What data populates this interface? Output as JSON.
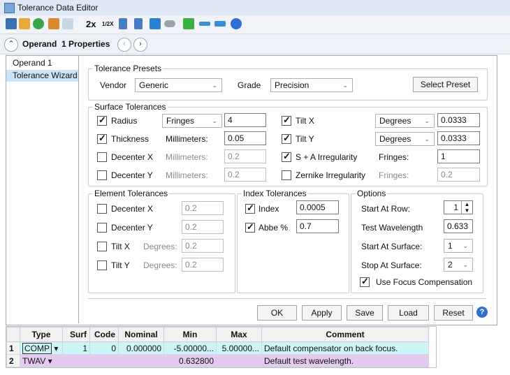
{
  "window": {
    "title": "Tolerance Data Editor"
  },
  "toolbar": {
    "icons": [
      "save-icon",
      "load-icon",
      "check-icon",
      "wizard-icon",
      "convert-icon",
      "double-icon",
      "half-icon",
      "sort-num-icon",
      "sort-alpha-icon",
      "undo-icon",
      "toggle-icon",
      "insert-row-icon",
      "dots-icon",
      "arrow-icon",
      "help-icon"
    ],
    "double_label": "2x",
    "half_label": "1/2X"
  },
  "operand_bar": {
    "label": "Operand  1 Properties"
  },
  "nav": {
    "items": [
      "Operand 1",
      "Tolerance Wizard"
    ],
    "selected": "Tolerance Wizard"
  },
  "presets": {
    "title": "Tolerance Presets",
    "vendor_label": "Vendor",
    "vendor_value": "Generic",
    "grade_label": "Grade",
    "grade_value": "Precision",
    "select_button": "Select Preset"
  },
  "surface": {
    "title": "Surface Tolerances",
    "radius": {
      "label": "Radius",
      "checked": true,
      "unit": "Fringes",
      "value": "4"
    },
    "thickness": {
      "label": "Thickness",
      "checked": true,
      "unit": "Millimeters:",
      "value": "0.05"
    },
    "decenter_x": {
      "label": "Decenter X",
      "checked": false,
      "unit": "Millimeters:",
      "value": "0.2"
    },
    "decenter_y": {
      "label": "Decenter Y",
      "checked": false,
      "unit": "Millimeters:",
      "value": "0.2"
    },
    "tilt_x": {
      "label": "Tilt X",
      "checked": true,
      "unit": "Degrees",
      "value": "0.0333"
    },
    "tilt_y": {
      "label": "Tilt Y",
      "checked": true,
      "unit": "Degrees",
      "value": "0.0333"
    },
    "sa_irreg": {
      "label": "S + A Irregularity",
      "checked": true,
      "unit": "Fringes:",
      "value": "1"
    },
    "zernike": {
      "label": "Zernike Irregularity",
      "checked": false,
      "unit": "Fringes:",
      "value": "0.2"
    }
  },
  "element": {
    "title": "Element Tolerances",
    "decenter_x": {
      "label": "Decenter X",
      "value": "0.2"
    },
    "decenter_y": {
      "label": "Decenter Y",
      "value": "0.2"
    },
    "tilt_x": {
      "label": "Tilt X",
      "unit": "Degrees:",
      "value": "0.2"
    },
    "tilt_y": {
      "label": "Tilt Y",
      "unit": "Degrees:",
      "value": "0.2"
    }
  },
  "index": {
    "title": "Index Tolerances",
    "index": {
      "label": "Index",
      "checked": true,
      "value": "0.0005"
    },
    "abbe": {
      "label": "Abbe %",
      "checked": true,
      "value": "0.7"
    }
  },
  "options": {
    "title": "Options",
    "start_row_label": "Start At Row:",
    "start_row_value": "1",
    "wavelength_label": "Test Wavelength",
    "wavelength_value": "0.633",
    "start_surface_label": "Start At Surface:",
    "start_surface_value": "1",
    "stop_surface_label": "Stop At Surface:",
    "stop_surface_value": "2",
    "focus_comp_label": "Use Focus Compensation",
    "focus_comp_checked": true
  },
  "buttons": {
    "ok": "OK",
    "apply": "Apply",
    "save": "Save",
    "load": "Load",
    "reset": "Reset"
  },
  "grid": {
    "headers": [
      "",
      "Type",
      "Surf",
      "Code",
      "Nominal",
      "Min",
      "Max",
      "Comment"
    ],
    "rows": [
      {
        "num": "1",
        "type": "COMP",
        "surf": "1",
        "code": "0",
        "nominal": "0.000000",
        "min": "-5.00000...",
        "max": "5.00000...",
        "comment": "Default compensator on back focus."
      },
      {
        "num": "2",
        "type": "TWAV",
        "surf": "",
        "code": "",
        "nominal": "",
        "min": "0.632800",
        "max": "",
        "comment": "Default test wavelength."
      }
    ]
  },
  "colors": {
    "row1": "#cdf5f7",
    "row2": "#e4c9f0",
    "nav_selected": "#cde3f7"
  }
}
